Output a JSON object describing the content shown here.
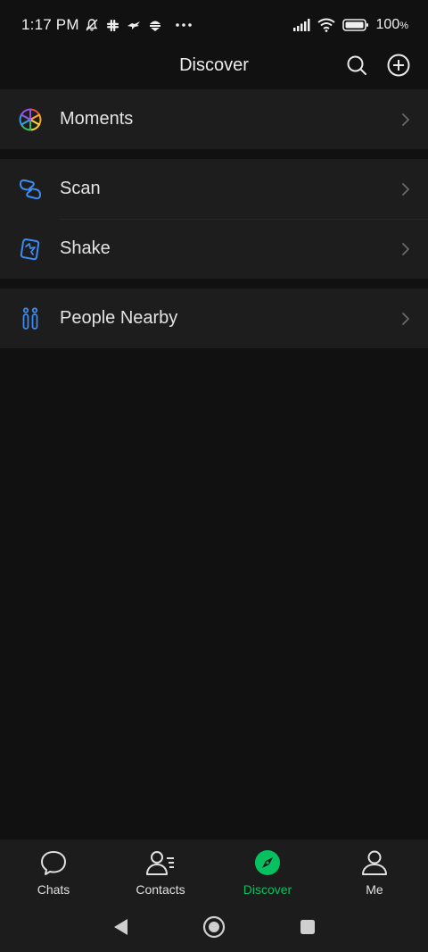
{
  "status_bar": {
    "time": "1:17 PM",
    "battery": "100",
    "battery_suffix": "%",
    "icons": [
      "mute-bell-icon",
      "slack-icon",
      "bird-icon",
      "android-icon",
      "more-dots-icon",
      "signal-icon",
      "wifi-icon",
      "battery-icon"
    ]
  },
  "app_bar": {
    "title": "Discover",
    "actions": [
      "search-icon",
      "add-circle-icon"
    ]
  },
  "menu": {
    "moments": {
      "label": "Moments",
      "icon": "moments-icon"
    },
    "scan": {
      "label": "Scan",
      "icon": "scan-icon"
    },
    "shake": {
      "label": "Shake",
      "icon": "shake-icon"
    },
    "people_nearby": {
      "label": "People Nearby",
      "icon": "people-nearby-icon"
    }
  },
  "bottom_nav": {
    "items": [
      {
        "label": "Chats",
        "icon": "chat-bubble-icon",
        "active": false
      },
      {
        "label": "Contacts",
        "icon": "contacts-icon",
        "active": false
      },
      {
        "label": "Discover",
        "icon": "compass-icon",
        "active": true
      },
      {
        "label": "Me",
        "icon": "person-icon",
        "active": false
      }
    ]
  },
  "colors": {
    "background": "#111111",
    "surface": "#1d1d1d",
    "accent": "#07c160",
    "icon_blue": "#3d8bf2",
    "text": "#e4e4e4",
    "chevron": "#6a6a6a"
  }
}
